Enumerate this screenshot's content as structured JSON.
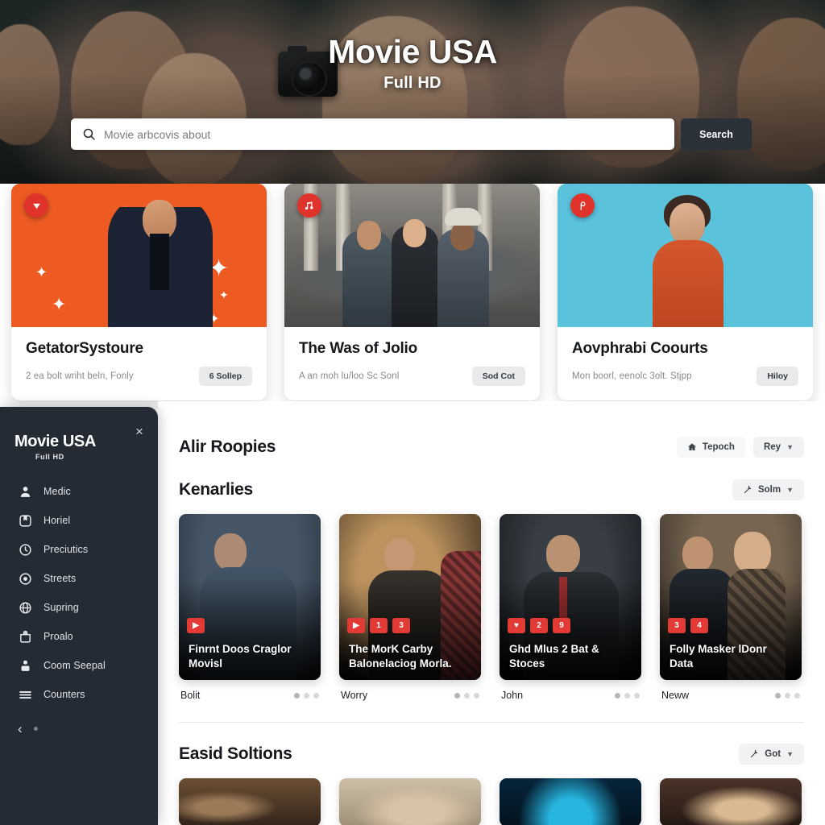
{
  "hero": {
    "title": "Movie USA",
    "subtitle": "Full HD"
  },
  "search": {
    "placeholder": "Movie arbcovis about",
    "value": "",
    "button_label": "Search",
    "icon": "search-icon"
  },
  "feature_cards": [
    {
      "title": "GetatorSystoure",
      "subtitle": "2 ea bolt wriht beln, Fonly",
      "pill": "6 Sollep",
      "badge_icon": "triangle-down-icon",
      "accent": "#ed5b23"
    },
    {
      "title": "The Was of Jolio",
      "subtitle": "A an moh lu/loo Sc Sonl",
      "pill": "Sod Cot",
      "badge_icon": "music-note-icon",
      "accent": "#6e6c68"
    },
    {
      "title": "Aovphrabi Coourts",
      "subtitle": "Mon boorl, eenolc 3olt. Stjpp",
      "pill": "Hiloy",
      "badge_icon": "spiral-p-icon",
      "accent": "#5bc2dc"
    }
  ],
  "sidebar": {
    "logo_main": "Movie USA",
    "logo_sub": "Full HD",
    "close_label": "×",
    "items": [
      {
        "label": "Medic",
        "icon": "person-icon"
      },
      {
        "label": "Horiel",
        "icon": "bookmark-box-icon"
      },
      {
        "label": "Preciutics",
        "icon": "clock-icon"
      },
      {
        "label": "Streets",
        "icon": "record-circle-icon"
      },
      {
        "label": "Supring",
        "icon": "globe-icon"
      },
      {
        "label": "Proalo",
        "icon": "bag-icon"
      },
      {
        "label": "Coom Seepal",
        "icon": "avatar-icon"
      },
      {
        "label": "Counters",
        "icon": "hamburger-icon"
      }
    ],
    "back_icon": "chevron-left-icon"
  },
  "sections": [
    {
      "title": "Alir Roopies",
      "actions": [
        {
          "label": "Tepoch",
          "icon": "home-icon",
          "caret": false
        },
        {
          "label": "Rey",
          "icon": "",
          "caret": true
        }
      ]
    },
    {
      "title": "Kenarlies",
      "actions": [
        {
          "label": "Solm",
          "icon": "magic-wand-icon",
          "caret": true
        }
      ]
    },
    {
      "title": "Easid Soltions",
      "actions": [
        {
          "label": "Got",
          "icon": "magic-wand-icon",
          "caret": true
        }
      ]
    }
  ],
  "movie_cards": [
    {
      "title": "Finrnt Doos Craglor Movisl",
      "owner": "Bolit",
      "badges": [
        "▶"
      ],
      "dots": 3
    },
    {
      "title": "The MorK Carby Balonelaciog Morla.",
      "owner": "Worry",
      "badges": [
        "▶",
        "1",
        "3"
      ],
      "dots": 3
    },
    {
      "title": "Ghd Mlus 2 Bat & Stoces",
      "owner": "John",
      "badges": [
        "♥",
        "2",
        "9"
      ],
      "dots": 3
    },
    {
      "title": "Folly Masker lDonr Data",
      "owner": "Neww",
      "badges": [
        "3",
        "4"
      ],
      "dots": 3
    }
  ],
  "bottom_thumbs": [
    {
      "name": "thumb-one"
    },
    {
      "name": "thumb-two"
    },
    {
      "name": "thumb-three"
    },
    {
      "name": "thumb-four"
    }
  ],
  "colors": {
    "accent_red": "#e33a35",
    "sidebar_bg": "#252b35",
    "search_btn": "#2b3139",
    "orange_card": "#ed5b23",
    "cyan_card": "#5bc2dc"
  }
}
